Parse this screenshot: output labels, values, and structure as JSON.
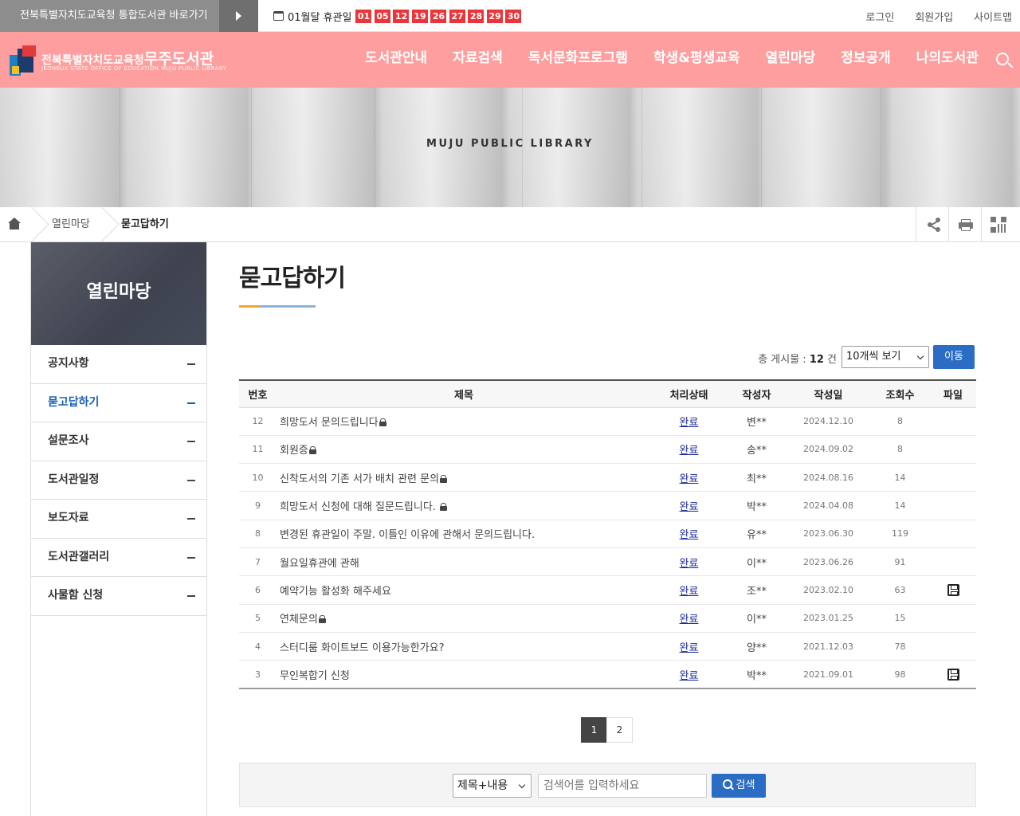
{
  "topbar": {
    "shortcut_label": "전북특별자치도교육청 통합도서관 바로가기",
    "closed_label": "01월달 휴관일",
    "closed_days": [
      "01",
      "05",
      "12",
      "19",
      "26",
      "27",
      "28",
      "29",
      "30"
    ],
    "login": "로그인",
    "join": "회원가입",
    "sitemap": "사이트맵"
  },
  "header": {
    "logo_main_prefix": "전북특별자치도교육청",
    "logo_main_name": "무주도서관",
    "logo_sub": "JEONBUK STATE OFFICE OF EDUCATION MUJU PUBLIC LIBRARY",
    "gnb": [
      "도서관안내",
      "자료검색",
      "독서문화프로그램",
      "학생&평생교육",
      "열린마당",
      "정보공개",
      "나의도서관"
    ]
  },
  "visual": {
    "text": "MUJU PUBLIC LIBRARY"
  },
  "location": {
    "items": [
      "열린마당",
      "묻고답하기"
    ]
  },
  "sidebar": {
    "title": "열린마당",
    "items": [
      {
        "label": "공지사항"
      },
      {
        "label": "묻고답하기"
      },
      {
        "label": "설문조사"
      },
      {
        "label": "도서관일정"
      },
      {
        "label": "보도자료"
      },
      {
        "label": "도서관갤러리"
      },
      {
        "label": "사물함 신청"
      }
    ]
  },
  "page": {
    "title": "묻고답하기",
    "total_prefix": "총 게시물 : ",
    "total_count": "12",
    "total_suffix": " 건",
    "per_page_select": "10개씩 보기",
    "go_button": "이동"
  },
  "board": {
    "headers": [
      "번호",
      "제목",
      "처리상태",
      "작성자",
      "작성일",
      "조회수",
      "파일"
    ],
    "rows": [
      {
        "num": "12",
        "title": "희망도서 문의드립니다",
        "lock": true,
        "status": "완료",
        "author": "변**",
        "date": "2024.12.10",
        "hits": "8",
        "file": false
      },
      {
        "num": "11",
        "title": "회원증",
        "lock": true,
        "status": "완료",
        "author": "송**",
        "date": "2024.09.02",
        "hits": "8",
        "file": false
      },
      {
        "num": "10",
        "title": "신착도서의 기존 서가 배치 관련 문의",
        "lock": true,
        "status": "완료",
        "author": "최**",
        "date": "2024.08.16",
        "hits": "14",
        "file": false
      },
      {
        "num": "9",
        "title": "희망도서 신청에 대해 질문드립니다. ",
        "lock": true,
        "status": "완료",
        "author": "박**",
        "date": "2024.04.08",
        "hits": "14",
        "file": false
      },
      {
        "num": "8",
        "title": "변경된 휴관일이 주말. 이틀인 이유에 관해서 문의드립니다.",
        "lock": false,
        "status": "완료",
        "author": "유**",
        "date": "2023.06.30",
        "hits": "119",
        "file": false
      },
      {
        "num": "7",
        "title": "월요일휴관에 관해",
        "lock": false,
        "status": "완료",
        "author": "이**",
        "date": "2023.06.26",
        "hits": "91",
        "file": false
      },
      {
        "num": "6",
        "title": "예약기능 활성화 해주세요",
        "lock": false,
        "status": "완료",
        "author": "조**",
        "date": "2023.02.10",
        "hits": "63",
        "file": true
      },
      {
        "num": "5",
        "title": "연체문의",
        "lock": true,
        "status": "완료",
        "author": "이**",
        "date": "2023.01.25",
        "hits": "15",
        "file": false
      },
      {
        "num": "4",
        "title": "스터디룸 화이트보드 이용가능한가요?",
        "lock": false,
        "status": "완료",
        "author": "양**",
        "date": "2021.12.03",
        "hits": "78",
        "file": false
      },
      {
        "num": "3",
        "title": "무인복합기 신청",
        "lock": false,
        "status": "완료",
        "author": "박**",
        "date": "2021.09.01",
        "hits": "98",
        "file": true
      }
    ]
  },
  "paging": {
    "pages": [
      "1",
      "2"
    ],
    "current": "1"
  },
  "search": {
    "field_select": "제목+내용",
    "placeholder": "검색어를 입력하세요",
    "button": "검색"
  },
  "colors": {
    "header_bg": "#ff9e9e",
    "closed_day_bg": "#e8363b",
    "accent_blue": "#2b6cc4",
    "sidebar_active": "#1a5fb4"
  }
}
